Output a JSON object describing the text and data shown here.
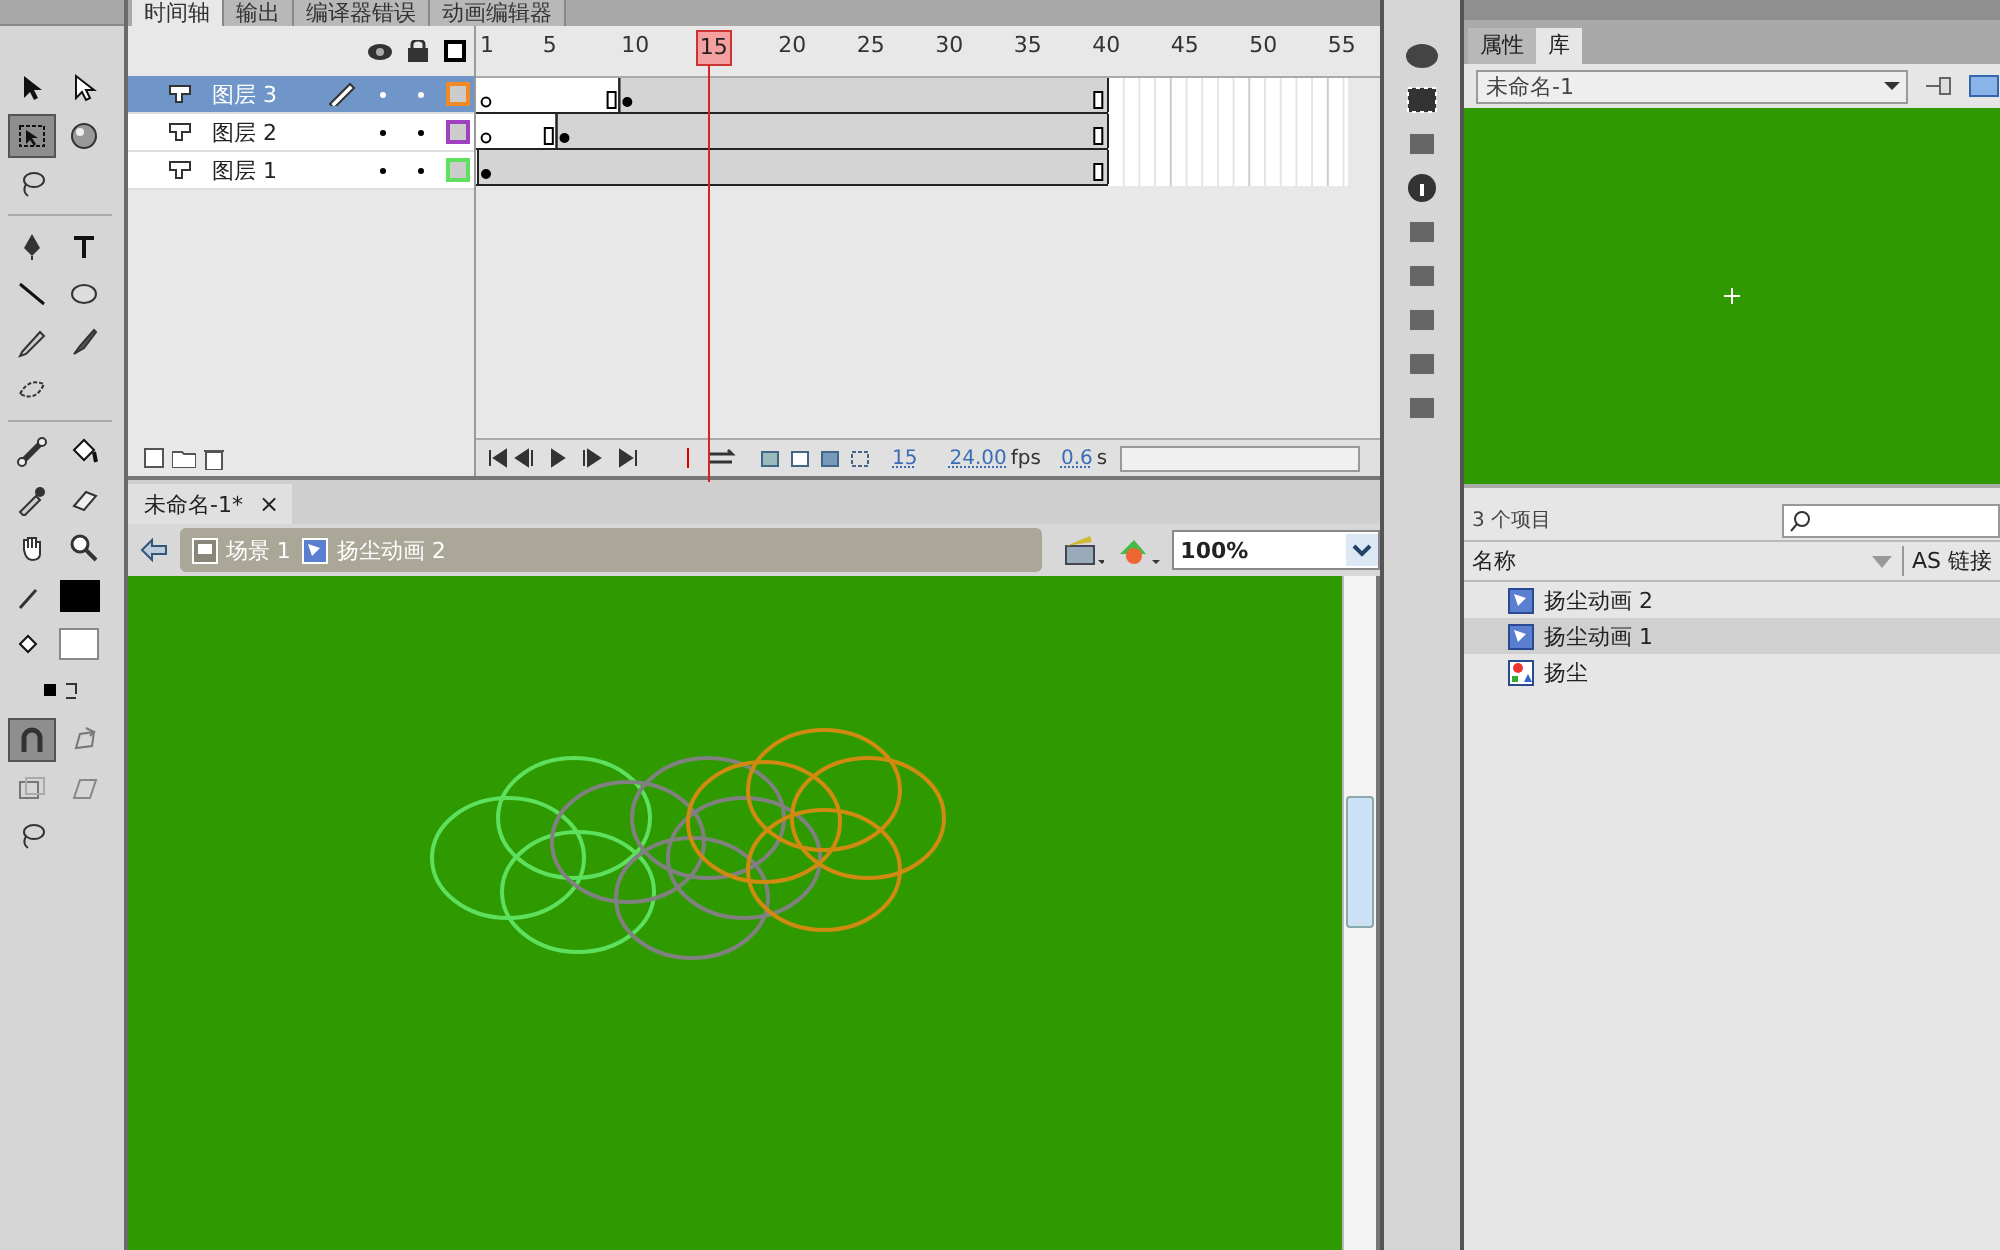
{
  "tool_groups": [
    {
      "tools": [
        {
          "kind": "arrow",
          "selected": false
        },
        {
          "kind": "subarrow",
          "selected": false
        },
        {
          "kind": "transform",
          "selected": true
        },
        {
          "kind": "sphere",
          "selected": false
        },
        {
          "kind": "lasso",
          "selected": false
        }
      ]
    },
    {
      "tools": [
        {
          "kind": "pen",
          "selected": false
        },
        {
          "kind": "text",
          "selected": false
        },
        {
          "kind": "line",
          "selected": false
        },
        {
          "kind": "oval",
          "selected": false
        },
        {
          "kind": "pencil",
          "selected": false
        },
        {
          "kind": "brush",
          "selected": false
        },
        {
          "kind": "deco",
          "selected": false
        }
      ]
    },
    {
      "tools": [
        {
          "kind": "bone",
          "selected": false
        },
        {
          "kind": "bucket",
          "selected": false
        },
        {
          "kind": "eyedropper",
          "selected": false
        },
        {
          "kind": "eraser",
          "selected": false
        },
        {
          "kind": "hand",
          "selected": false
        },
        {
          "kind": "zoom",
          "selected": false
        },
        {
          "kind": "stroke",
          "selected": false
        },
        {
          "kind": "fill",
          "selected": false
        },
        {
          "kind": "swap",
          "selected": false
        },
        {
          "kind": "magnet",
          "selected": true
        },
        {
          "kind": "smooth",
          "selected": false
        },
        {
          "kind": "scale",
          "selected": false
        },
        {
          "kind": "rotate",
          "selected": false
        },
        {
          "kind": "lassomode",
          "selected": false
        }
      ]
    }
  ],
  "timeline": {
    "tabs": [
      {
        "label": "时间轴",
        "selected": true
      },
      {
        "label": "输出",
        "selected": false
      },
      {
        "label": "编译器错误",
        "selected": false
      },
      {
        "label": "动画编辑器",
        "selected": false
      }
    ],
    "ruler": [
      "1",
      "5",
      "10",
      "20",
      "25",
      "30",
      "35",
      "40",
      "45",
      "50",
      "55"
    ],
    "playhead": "15",
    "layers": [
      {
        "name": "图层 3",
        "selected": true,
        "editing": true,
        "color": "#f08a24",
        "frames": [
          {
            "kind": "empty"
          },
          {
            "kind": "blank"
          },
          {
            "kind": "blank"
          },
          {
            "kind": "blank"
          },
          {
            "kind": "blank"
          },
          {
            "kind": "blank"
          },
          {
            "kind": "blank"
          },
          {
            "kind": "blank"
          },
          {
            "kind": "end"
          },
          {
            "kind": "key"
          },
          {
            "kind": "fill"
          },
          {
            "kind": "fill"
          },
          {
            "kind": "fill"
          },
          {
            "kind": "fill"
          },
          {
            "kind": "fill"
          },
          {
            "kind": "fill"
          },
          {
            "kind": "fill"
          },
          {
            "kind": "fill"
          },
          {
            "kind": "fill"
          },
          {
            "kind": "fill"
          },
          {
            "kind": "fill"
          },
          {
            "kind": "fill"
          },
          {
            "kind": "fill"
          },
          {
            "kind": "fill"
          },
          {
            "kind": "fill"
          },
          {
            "kind": "fill"
          },
          {
            "kind": "fill"
          },
          {
            "kind": "fill"
          },
          {
            "kind": "fill"
          },
          {
            "kind": "fill"
          },
          {
            "kind": "fill"
          },
          {
            "kind": "fill"
          },
          {
            "kind": "fill"
          },
          {
            "kind": "fill"
          },
          {
            "kind": "fill"
          },
          {
            "kind": "fill"
          },
          {
            "kind": "fill"
          },
          {
            "kind": "fill"
          },
          {
            "kind": "fill"
          },
          {
            "kind": "end"
          }
        ]
      },
      {
        "name": "图层 2",
        "selected": false,
        "editing": false,
        "color": "#a040c0",
        "frames": [
          {
            "kind": "empty"
          },
          {
            "kind": "blank"
          },
          {
            "kind": "blank"
          },
          {
            "kind": "blank"
          },
          {
            "kind": "end"
          },
          {
            "kind": "key"
          },
          {
            "kind": "fill"
          },
          {
            "kind": "fill"
          },
          {
            "kind": "fill"
          },
          {
            "kind": "fill"
          },
          {
            "kind": "fill"
          },
          {
            "kind": "fill"
          },
          {
            "kind": "fill"
          },
          {
            "kind": "fill"
          },
          {
            "kind": "fill"
          },
          {
            "kind": "fill"
          },
          {
            "kind": "fill"
          },
          {
            "kind": "fill"
          },
          {
            "kind": "fill"
          },
          {
            "kind": "fill"
          },
          {
            "kind": "fill"
          },
          {
            "kind": "fill"
          },
          {
            "kind": "fill"
          },
          {
            "kind": "fill"
          },
          {
            "kind": "fill"
          },
          {
            "kind": "fill"
          },
          {
            "kind": "fill"
          },
          {
            "kind": "fill"
          },
          {
            "kind": "fill"
          },
          {
            "kind": "fill"
          },
          {
            "kind": "fill"
          },
          {
            "kind": "fill"
          },
          {
            "kind": "fill"
          },
          {
            "kind": "fill"
          },
          {
            "kind": "fill"
          },
          {
            "kind": "fill"
          },
          {
            "kind": "fill"
          },
          {
            "kind": "fill"
          },
          {
            "kind": "fill"
          },
          {
            "kind": "end"
          }
        ]
      },
      {
        "name": "图层 1",
        "selected": false,
        "editing": false,
        "color": "#60e060",
        "frames": [
          {
            "kind": "key"
          },
          {
            "kind": "fill"
          },
          {
            "kind": "fill"
          },
          {
            "kind": "fill"
          },
          {
            "kind": "fill"
          },
          {
            "kind": "fill"
          },
          {
            "kind": "fill"
          },
          {
            "kind": "fill"
          },
          {
            "kind": "fill"
          },
          {
            "kind": "fill"
          },
          {
            "kind": "fill"
          },
          {
            "kind": "fill"
          },
          {
            "kind": "fill"
          },
          {
            "kind": "fill"
          },
          {
            "kind": "fill"
          },
          {
            "kind": "fill"
          },
          {
            "kind": "fill"
          },
          {
            "kind": "fill"
          },
          {
            "kind": "fill"
          },
          {
            "kind": "fill"
          },
          {
            "kind": "fill"
          },
          {
            "kind": "fill"
          },
          {
            "kind": "fill"
          },
          {
            "kind": "fill"
          },
          {
            "kind": "fill"
          },
          {
            "kind": "fill"
          },
          {
            "kind": "fill"
          },
          {
            "kind": "fill"
          },
          {
            "kind": "fill"
          },
          {
            "kind": "fill"
          },
          {
            "kind": "fill"
          },
          {
            "kind": "fill"
          },
          {
            "kind": "fill"
          },
          {
            "kind": "fill"
          },
          {
            "kind": "fill"
          },
          {
            "kind": "fill"
          },
          {
            "kind": "fill"
          },
          {
            "kind": "fill"
          },
          {
            "kind": "fill"
          },
          {
            "kind": "end"
          }
        ]
      }
    ],
    "current_frame": "15",
    "fps": "24.00",
    "fps_unit": "fps",
    "time": "0.6",
    "time_unit": "s"
  },
  "document": {
    "tab": "未命名-1*",
    "close": "×",
    "breadcrumb": [
      {
        "label": "场景 1",
        "kind": "scene"
      },
      {
        "label": "扬尘动画 2",
        "kind": "symbol"
      }
    ],
    "zoom": "100%"
  },
  "library": {
    "tabs": [
      {
        "label": "属性",
        "selected": false
      },
      {
        "label": "库",
        "selected": true
      }
    ],
    "document": "未命名-1",
    "count": "3 个项目",
    "columns": [
      "名称",
      "AS 链接"
    ],
    "items": [
      {
        "name": "扬尘动画 2",
        "kind": "movieclip",
        "selected": false
      },
      {
        "name": "扬尘动画 1",
        "kind": "movieclip",
        "selected": true
      },
      {
        "name": "扬尘",
        "kind": "graphic",
        "selected": false
      }
    ]
  }
}
